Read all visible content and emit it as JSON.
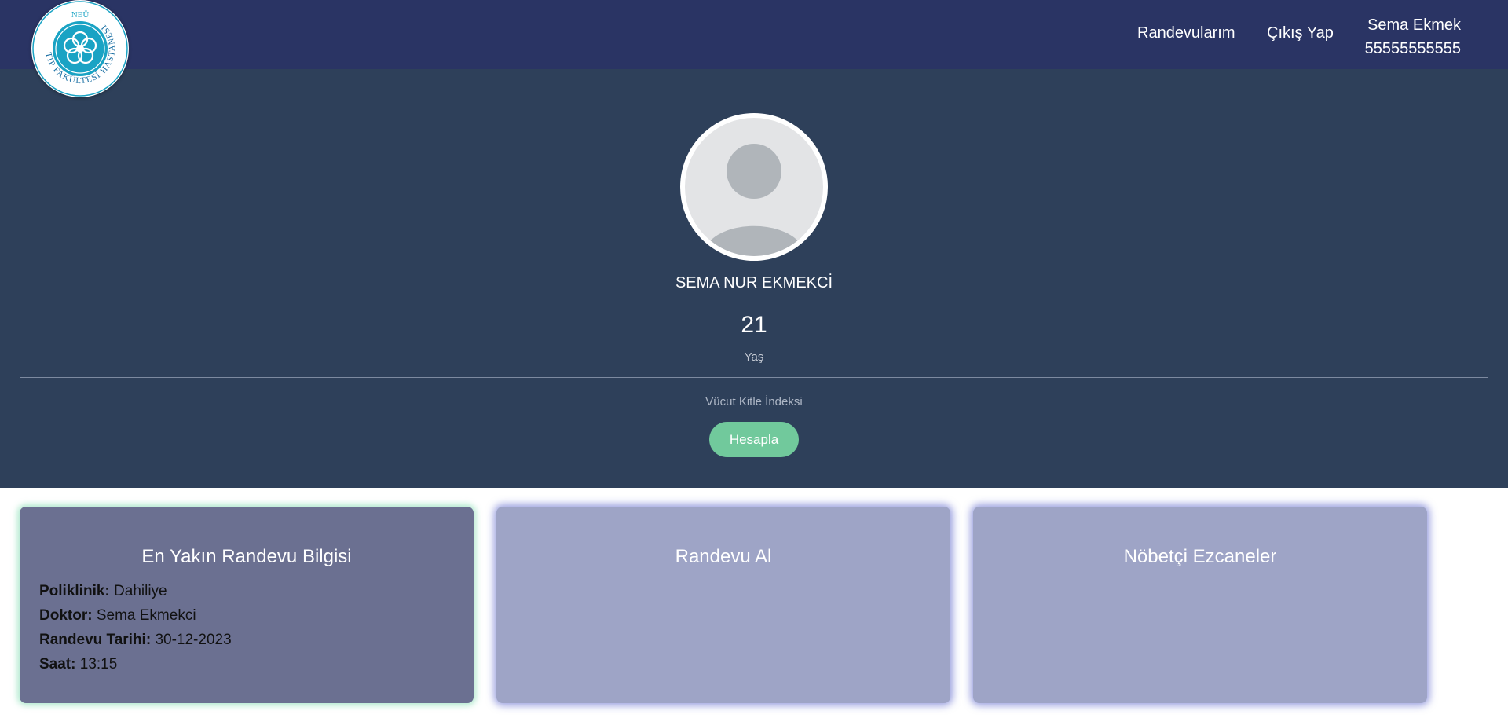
{
  "nav": {
    "links": [
      "Randevularım",
      "Çıkış Yap"
    ],
    "user_name": "Sema Ekmek",
    "user_phone": "55555555555"
  },
  "logo": {
    "top_text": "NEÜ",
    "ring_text": "TIP FAKÜLTESİ HASTANESİ"
  },
  "profile": {
    "name": "SEMA NUR EKMEKCİ",
    "age": "21",
    "age_label": "Yaş",
    "bmi_label": "Vücut Kitle İndeksi",
    "calc_button": "Hesapla"
  },
  "cards": {
    "appointment": {
      "title": "En Yakın Randevu Bilgisi",
      "rows": [
        {
          "label": "Poliklinik:",
          "value": "Dahiliye"
        },
        {
          "label": "Doktor:",
          "value": "Sema Ekmekci"
        },
        {
          "label": "Randevu Tarihi:",
          "value": "30-12-2023"
        },
        {
          "label": "Saat:",
          "value": "13:15"
        }
      ]
    },
    "book_title": "Randevu Al",
    "pharmacy_title": "Nöbetçi Ezcaneler"
  },
  "colors": {
    "navbar": "#2a3464",
    "profile_bg": "#2e405a",
    "accent_button": "#71c99c",
    "card_dark": "#6b7091",
    "card_light": "#9ea4c6",
    "logo_teal": "#1aa3c4"
  }
}
